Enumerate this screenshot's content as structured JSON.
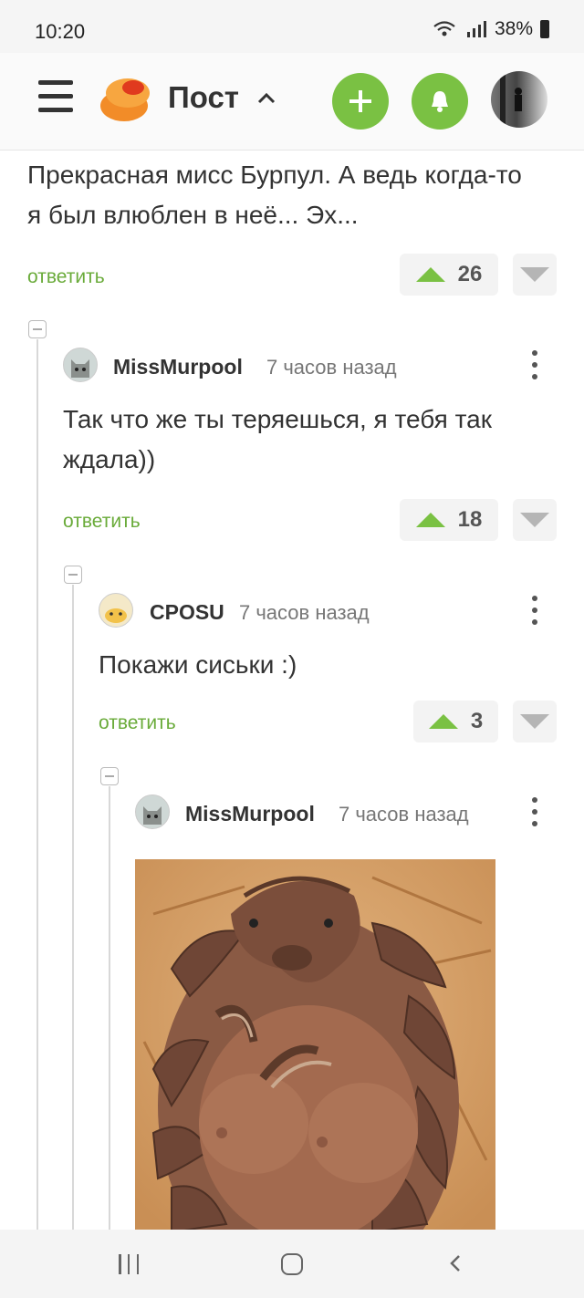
{
  "status_bar": {
    "time": "10:20",
    "battery": "38%",
    "icons": [
      "wifi-icon",
      "signal-icon",
      "battery-icon"
    ]
  },
  "header": {
    "title": "Пост",
    "icons": [
      "menu-icon",
      "logo-icon",
      "chevron-up-icon",
      "add-icon",
      "bell-icon",
      "avatar"
    ]
  },
  "colors": {
    "accent_green": "#7ac143",
    "reply_green": "#6aab3a",
    "brand_orange": "#f28c28"
  },
  "comments": [
    {
      "text": "Прекрасная мисс Бурпул. А ведь когда-то я был влюблен в неё... Эх...",
      "reply": "ответить",
      "votes": "26"
    },
    {
      "author": "MissMurpool",
      "time": "7 часов назад",
      "text": "Так что же ты теряешься, я тебя так ждала))",
      "reply": "ответить",
      "votes": "18"
    },
    {
      "author": "CPOSU",
      "time": "7 часов назад",
      "text": "Покажи сиськи :)",
      "reply": "ответить",
      "votes": "3"
    },
    {
      "author": "MissMurpool",
      "time": "7 часов назад",
      "image": "pangolin-photo"
    }
  ],
  "nav_bar": {
    "icons": [
      "recent-apps-icon",
      "home-icon",
      "back-icon"
    ]
  }
}
